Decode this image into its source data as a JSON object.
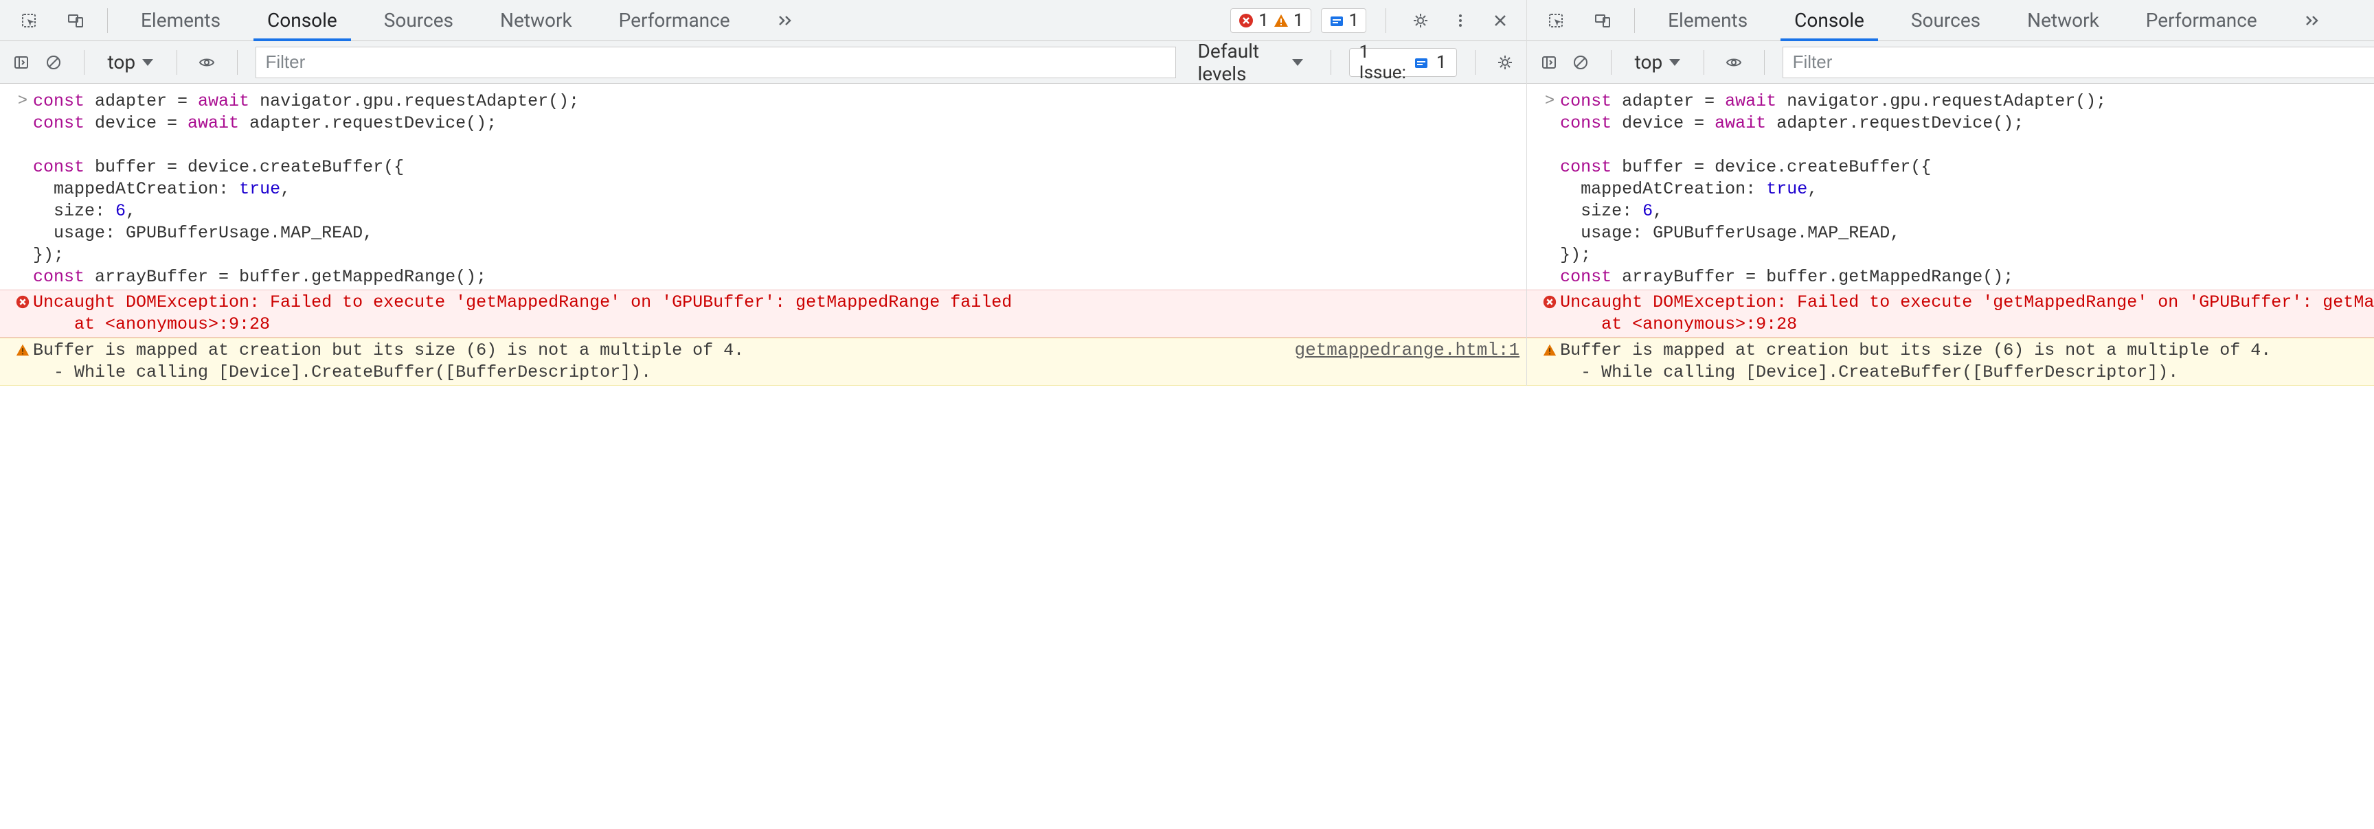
{
  "tabs": {
    "elements": "Elements",
    "console": "Console",
    "sources": "Sources",
    "network": "Network",
    "performance": "Performance"
  },
  "counters": {
    "errors": "1",
    "warnings": "1",
    "info": "1"
  },
  "toolbar": {
    "context": "top",
    "filter_placeholder": "Filter",
    "levels": "Default levels",
    "issues_label": "1 Issue:",
    "issues_count": "1"
  },
  "code": {
    "l1a": "const",
    "l1b": " adapter = ",
    "l1c": "await",
    "l1d": " navigator.gpu.requestAdapter();",
    "l2a": "const",
    "l2b": " device = ",
    "l2c": "await",
    "l2d": " adapter.requestDevice();",
    "blank": "",
    "l4a": "const",
    "l4b": " buffer = device.createBuffer({",
    "l5a": "  mappedAtCreation: ",
    "l5b": "true",
    "l5c": ",",
    "l6a": "  size: ",
    "l6b": "6",
    "l6c": ",",
    "l7": "  usage: GPUBufferUsage.MAP_READ,",
    "l8": "});",
    "l9a": "const",
    "l9b": " arrayBuffer = buffer.getMappedRange();"
  },
  "error": {
    "line1": "Uncaught DOMException: Failed to execute 'getMappedRange' on 'GPUBuffer': getMappedRange failed",
    "line2": "    at <anonymous>:9:28"
  },
  "warning": {
    "line1": "Buffer is mapped at creation but its size (6) is not a multiple of 4.",
    "line2": "  - While calling [Device].CreateBuffer([BufferDescriptor]).",
    "source": "getmappedrange.html:1"
  },
  "prompt": ">"
}
